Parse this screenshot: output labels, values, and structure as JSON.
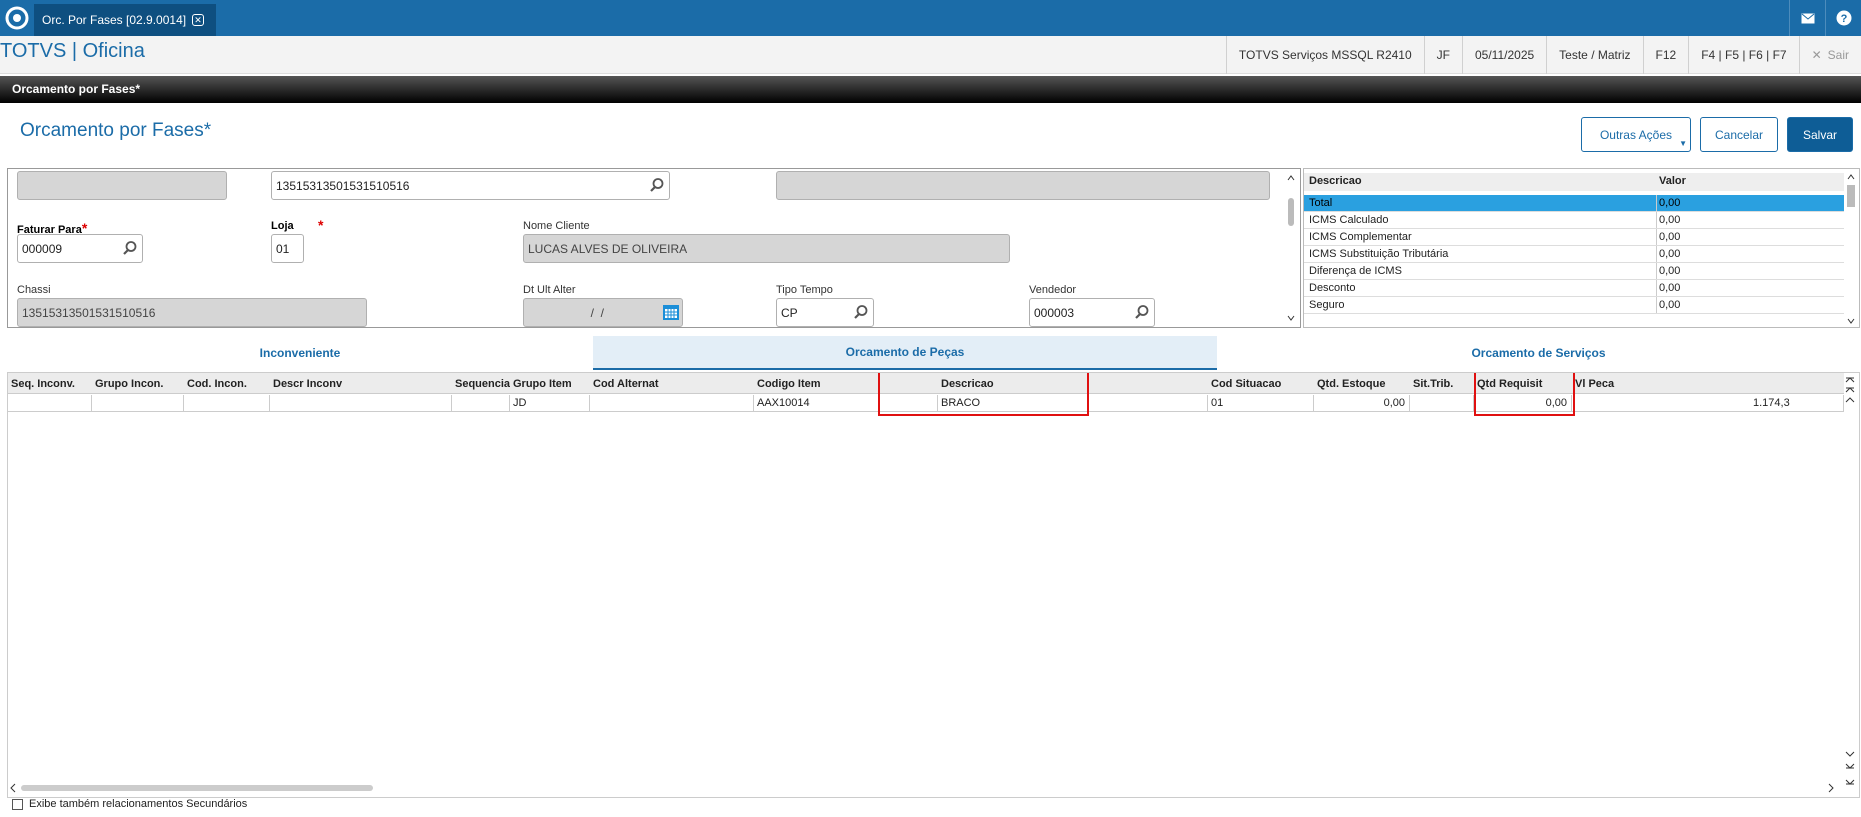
{
  "topbar": {
    "tab_title": "Orc. Por Fases [02.9.0014]",
    "icons": [
      "totvs-logo-icon",
      "close-icon",
      "mail-icon",
      "help-icon"
    ]
  },
  "appbar": {
    "brand": "TOTVS | Oficina",
    "environment": "TOTVS Serviços MSSQL R2410",
    "user": "JF",
    "date": "05/11/2025",
    "company": "Teste / Matriz",
    "shortcut_f12": "F12",
    "shortcuts": "F4 | F5 | F6 | F7",
    "exit_label": "Sair"
  },
  "window_title": "Orcamento por Fases*",
  "form": {
    "title": "Orcamento por Fases*",
    "buttons": {
      "more": "Outras Ações",
      "cancel": "Cancelar",
      "save": "Salvar"
    },
    "field_top_code": "13515313501531510516",
    "faturar_para": {
      "label": "Faturar Para",
      "required": "*",
      "value": "000009"
    },
    "loja": {
      "label": "Loja",
      "required": "*",
      "value": "01"
    },
    "nome_cliente": {
      "label": "Nome Cliente",
      "value": "LUCAS ALVES DE OLIVEIRA"
    },
    "chassi": {
      "label": "Chassi",
      "value": "13515313501531510516"
    },
    "dt_ult_alter": {
      "label": "Dt Ult Alter",
      "value": "  /  /"
    },
    "tipo_tempo": {
      "label": "Tipo Tempo",
      "value": "CP"
    },
    "vendedor": {
      "label": "Vendedor",
      "value": "000003"
    }
  },
  "totals": {
    "headers": {
      "descricao": "Descricao",
      "valor": "Valor"
    },
    "rows": [
      {
        "descricao": "Total",
        "valor": "0,00"
      },
      {
        "descricao": "ICMS Calculado",
        "valor": "0,00"
      },
      {
        "descricao": "ICMS Complementar",
        "valor": "0,00"
      },
      {
        "descricao": "ICMS Substituição Tributária",
        "valor": "0,00"
      },
      {
        "descricao": "Diferença de ICMS",
        "valor": "0,00"
      },
      {
        "descricao": "Desconto",
        "valor": "0,00"
      },
      {
        "descricao": "Seguro",
        "valor": "0,00"
      }
    ]
  },
  "tabs": [
    "Inconveniente",
    "Orcamento de Peças",
    "Orcamento de Serviços"
  ],
  "grid": {
    "headers": [
      "Seq. Inconv.",
      "Grupo Incon.",
      "Cod. Incon.",
      "Descr Inconv",
      "Sequencia",
      "Grupo Item",
      "Cod Alternat",
      "Codigo Item",
      "Descricao",
      "Cod Situacao",
      "Qtd. Estoque",
      "Sit.Trib.",
      "Qtd Requisit",
      "Vl Peca"
    ],
    "row": [
      "",
      "",
      "",
      "",
      "",
      "JD",
      "",
      "AAX10014",
      "BRACO",
      "01",
      "0,00",
      "",
      "0,00",
      "1.174,3"
    ]
  },
  "footer_checkbox": "Exibe também relacionamentos Secundários",
  "colors": {
    "accent": "#1b6ca8",
    "highlight": "#e01010",
    "selected_row": "#2aa0e0"
  }
}
